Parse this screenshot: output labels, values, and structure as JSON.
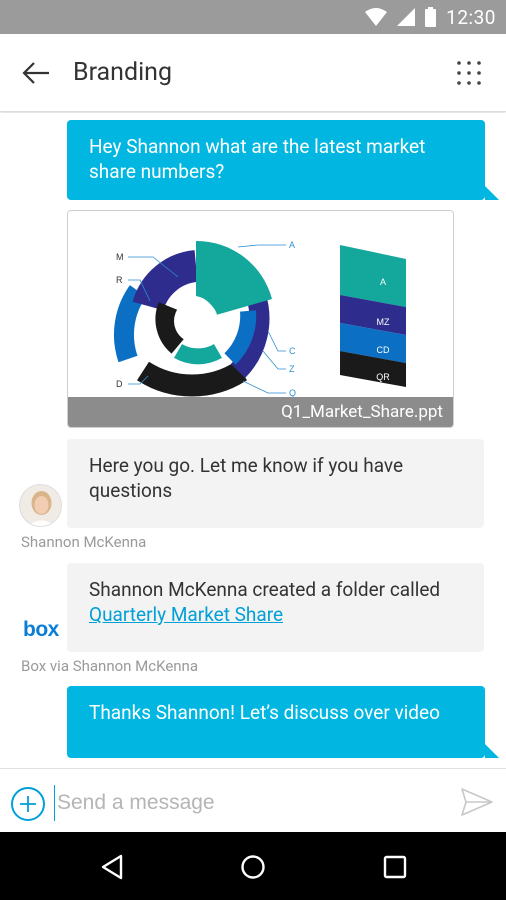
{
  "status_bar": {
    "time": "12:30"
  },
  "header": {
    "title": "Branding"
  },
  "messages": [
    {
      "type": "outgoing",
      "text": "Hey Shannon what are the latest market share numbers?"
    },
    {
      "type": "attachment",
      "file_name": "Q1_Market_Share.ppt",
      "chart_labels": {
        "left": [
          "M",
          "R",
          "D"
        ],
        "right": [
          "A",
          "C",
          "Z",
          "Q"
        ],
        "stack": [
          "A",
          "MZ",
          "CD",
          "QR"
        ]
      }
    },
    {
      "type": "incoming",
      "text": "Here you go. Let me know if you have questions",
      "sender": "Shannon McKenna"
    },
    {
      "type": "incoming",
      "text_prefix": "Shannon McKenna created a folder called ",
      "link_text": "Quarterly Market Share",
      "sender": "Box via Shannon McKenna",
      "logo": "box"
    },
    {
      "type": "outgoing",
      "text": "Thanks Shannon! Let’s discuss over video"
    }
  ],
  "composer": {
    "placeholder": "Send a message"
  },
  "colors": {
    "accent": "#01b7e2",
    "link": "#01a0d6",
    "teal": "#14a79b",
    "navy": "#2e2d8d",
    "blue": "#0b6fc4",
    "black": "#1a1a1a"
  }
}
